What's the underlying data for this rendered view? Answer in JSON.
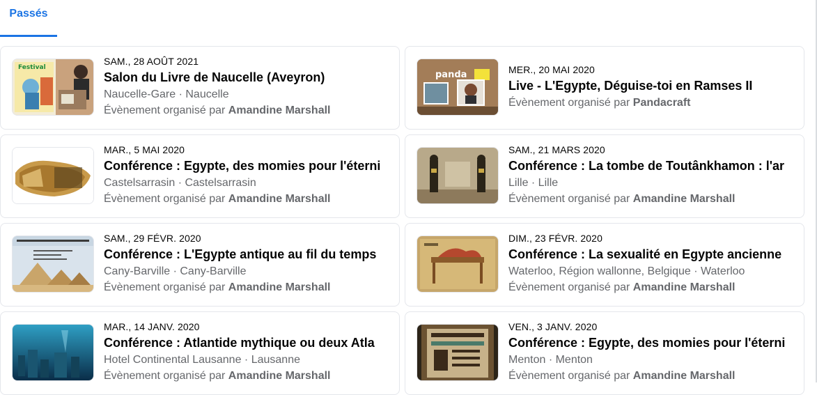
{
  "tabs": {
    "past_label": "Passés"
  },
  "organizer_prefix": "Évènement organisé par ",
  "events": [
    {
      "date": "SAM., 28 AOÛT 2021",
      "title": "Salon du Livre de Naucelle (Aveyron)",
      "location": "Naucelle-Gare · Naucelle",
      "organizer": "Amandine Marshall",
      "thumb": "bd-festival"
    },
    {
      "date": "MER., 20 MAI 2020",
      "title": "Live - L'Egypte, Déguise-toi en Ramses II",
      "location": "",
      "organizer": "Pandacraft",
      "thumb": "pandacraft-live"
    },
    {
      "date": "MAR., 5 MAI 2020",
      "title": "Conférence : Egypte, des momies pour l'éterni",
      "location": "Castelsarrasin · Castelsarrasin",
      "organizer": "Amandine Marshall",
      "thumb": "mummy"
    },
    {
      "date": "SAM., 21 MARS 2020",
      "title": "Conférence : La tombe de Toutânkhamon : l'ar",
      "location": "Lille · Lille",
      "organizer": "Amandine Marshall",
      "thumb": "tomb-statues"
    },
    {
      "date": "SAM., 29 FÉVR. 2020",
      "title": "Conférence : L'Egypte antique au fil du temps",
      "location": "Cany-Barville · Cany-Barville",
      "organizer": "Amandine Marshall",
      "thumb": "pyramids-poster"
    },
    {
      "date": "DIM., 23 FÉVR. 2020",
      "title": "Conférence : La sexualité en Egypte ancienne",
      "location": "Waterloo, Région wallonne, Belgique · Waterloo",
      "organizer": "Amandine Marshall",
      "thumb": "bed-relief"
    },
    {
      "date": "MAR., 14 JANV. 2020",
      "title": "Conférence : Atlantide mythique ou deux Atla",
      "location": "Hotel Continental Lausanne · Lausanne",
      "organizer": "Amandine Marshall",
      "thumb": "atlantis"
    },
    {
      "date": "VEN., 3 JANV. 2020",
      "title": "Conférence : Egypte, des momies pour l'éterni",
      "location": "Menton · Menton",
      "organizer": "Amandine Marshall",
      "thumb": "sarcophagus"
    }
  ]
}
